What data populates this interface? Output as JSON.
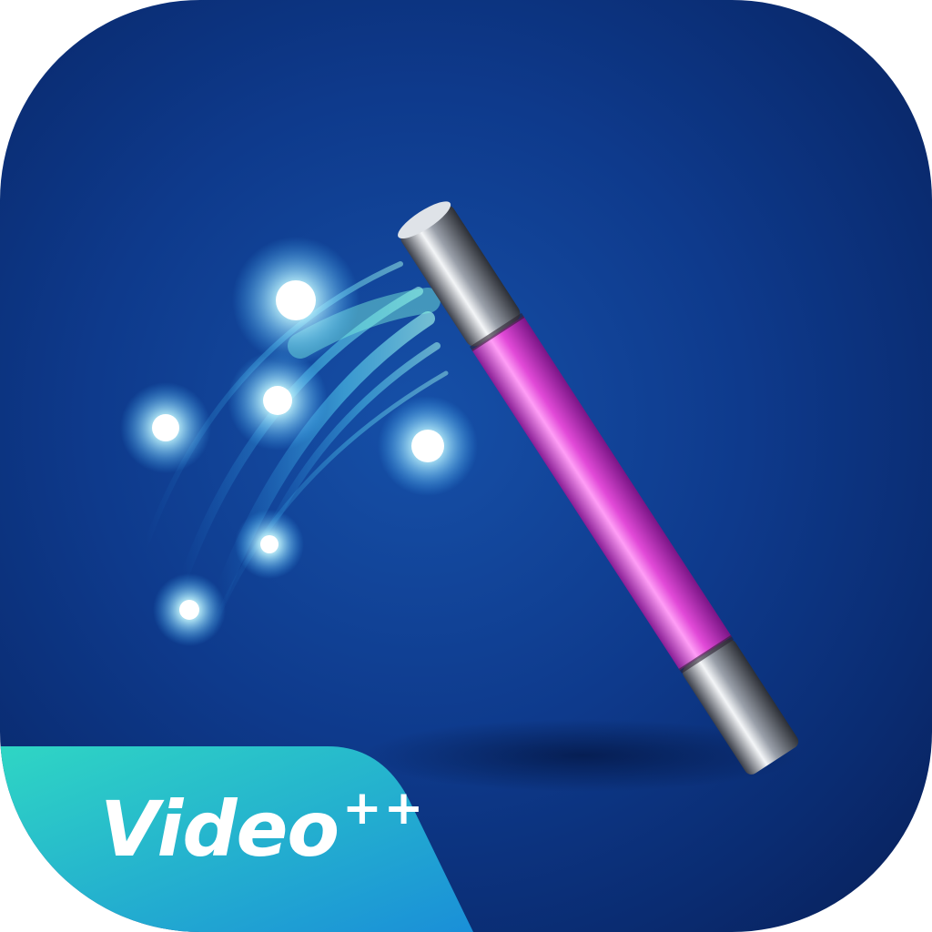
{
  "app_icon": {
    "badge_text": "Video",
    "badge_superscript": "++",
    "icon_name": "magic-wand-icon",
    "colors": {
      "background": "#0e3a8c",
      "wand_shaft": "#d63bd0",
      "badge_start": "#2fd6c4",
      "badge_end": "#1a8fd8",
      "sparkle": "#aef4ff"
    }
  }
}
